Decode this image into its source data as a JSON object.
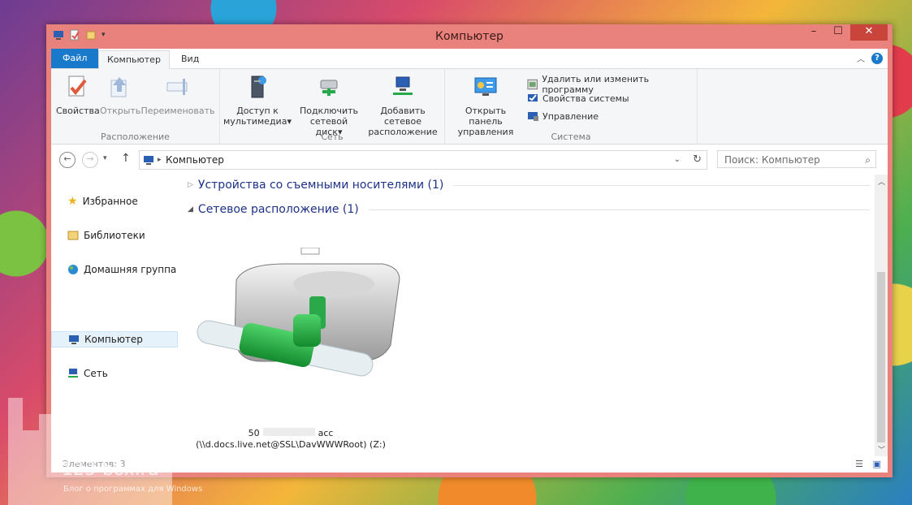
{
  "window": {
    "title": "Компьютер"
  },
  "controls": {
    "minimize": "–",
    "maximize": "☐",
    "close": "✕"
  },
  "tabs": {
    "file": "Файл",
    "computer": "Компьютер",
    "view": "Вид",
    "help": "?"
  },
  "ribbon": {
    "location": {
      "label": "Расположение",
      "properties": "Свойства",
      "open": "Открыть",
      "rename": "Переименовать"
    },
    "network": {
      "label": "Сеть",
      "media_line1": "Доступ к",
      "media_line2": "мультимедиа",
      "map_line1": "Подключить",
      "map_line2": "сетевой диск",
      "add_line1": "Добавить сетевое",
      "add_line2": "расположение"
    },
    "system": {
      "label": "Система",
      "cp_line1": "Открыть панель",
      "cp_line2": "управления",
      "uninstall": "Удалить или изменить программу",
      "sysprops": "Свойства системы",
      "manage": "Управление"
    }
  },
  "address": {
    "path": "Компьютер",
    "search_placeholder": "Поиск: Компьютер"
  },
  "nav": {
    "favorites": "Избранное",
    "libraries": "Библиотеки",
    "homegroup": "Домашняя группа",
    "computer": "Компьютер",
    "network": "Сеть"
  },
  "content": {
    "removable_header": "Устройства со съемными носителями (1)",
    "network_header": "Сетевое расположение (1)",
    "drive_name_prefix": "50",
    "drive_name_suffix": "acc",
    "drive_path": "(\\\\d.docs.live.net@SSL\\DavWWWRoot) (Z:)"
  },
  "status": {
    "items": "Элементов: 3"
  },
  "watermark": {
    "site": "123-box.ru",
    "tagline": "Блог о программах для Windows"
  },
  "colors": {
    "accent": "#1979ca",
    "frame": "#e9827c",
    "close": "#c9453c",
    "header_text": "#1e3287"
  }
}
